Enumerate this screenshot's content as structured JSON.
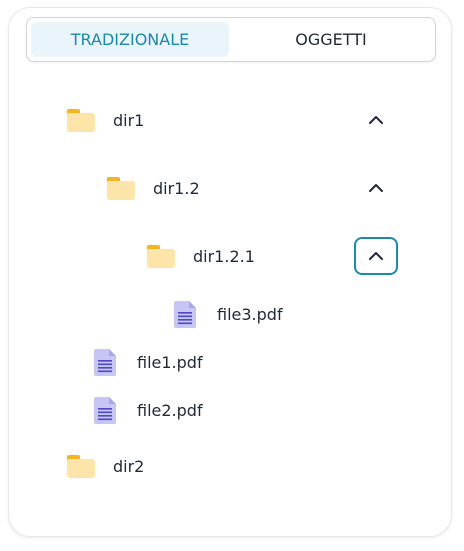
{
  "tabs": {
    "traditional": "TRADIZIONALE",
    "objects": "OGGETTI"
  },
  "tree": {
    "dir1": "dir1",
    "dir1_2": "dir1.2",
    "dir1_2_1": "dir1.2.1",
    "file3": "file3.pdf",
    "file1": "file1.pdf",
    "file2": "file2.pdf",
    "dir2": "dir2"
  },
  "colors": {
    "accent": "#1c8aa8",
    "active_tab_bg": "#e9f4fb",
    "folder_tab": "#f6b324",
    "folder_body": "#fde4a8",
    "file_icon": "#c7c5f3",
    "file_lines": "#4f46c9"
  },
  "icons": {
    "folder": "folder-icon",
    "file": "pdf-file-icon",
    "collapse": "chevron-up-icon"
  }
}
